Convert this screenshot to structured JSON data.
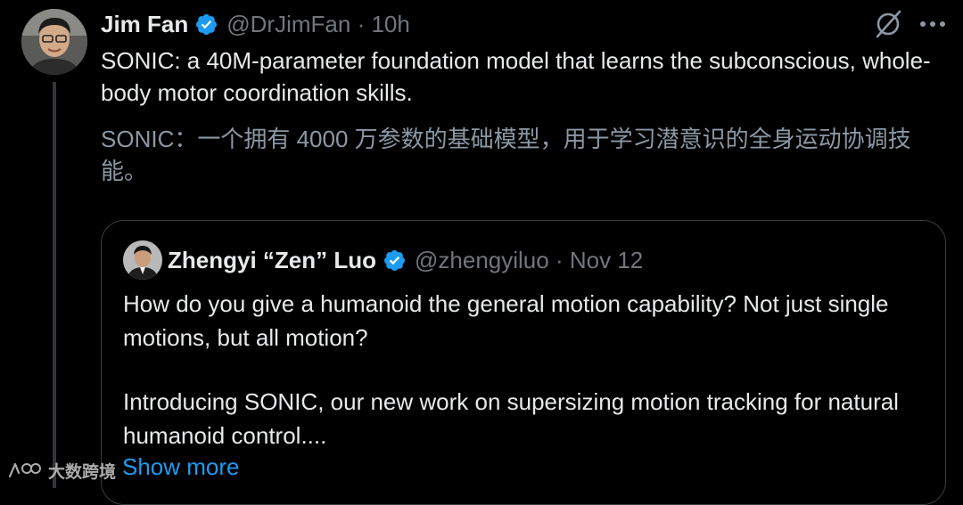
{
  "tweet": {
    "author_name": "Jim Fan",
    "author_handle": "@DrJimFan",
    "separator": "·",
    "time": "10h",
    "text": "SONIC: a 40M-parameter foundation model that learns the subconscious, whole-body motor coordination skills.",
    "translation": "SONIC：一个拥有 4000 万参数的基础模型，用于学习潜意识的全身运动协调技能。"
  },
  "quote": {
    "author_name": "Zhengyi “Zen” Luo",
    "author_handle": "@zhengyiluo",
    "separator": "·",
    "time": "Nov 12",
    "paragraph_1": "How do you give a humanoid the general motion capability? Not just single motions, but all motion?",
    "paragraph_2": "Introducing SONIC, our new work on supersizing motion tracking for natural humanoid control....",
    "show_more_label": "Show more"
  },
  "watermark": {
    "text": "大数跨境"
  },
  "icons": {
    "verified": "verified-badge-icon",
    "grok": "grok-icon",
    "more": "more-options-icon"
  },
  "colors": {
    "background": "#000000",
    "text_primary": "#e7e9ea",
    "text_secondary": "#71767b",
    "translation": "#8b98a5",
    "link": "#1d9bf0",
    "verified": "#1d9bf0",
    "border": "#3a3d40"
  }
}
